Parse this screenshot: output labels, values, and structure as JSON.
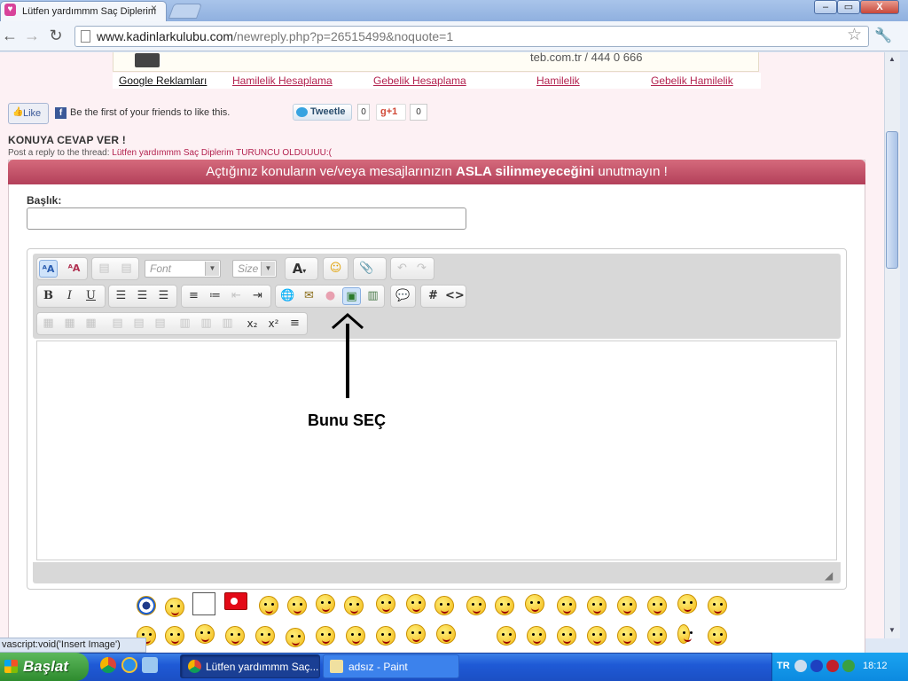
{
  "browser": {
    "tab_title": "Lütfen yardımmm Saç Diplerim",
    "tab_close": "×",
    "window_buttons": {
      "minimize": "–",
      "restore": "▭",
      "close": "X"
    },
    "url_host": "www.kadinlarkulubu.com",
    "url_path": "/newreply.php?p=26515499&noquote=1",
    "nav": {
      "back": "←",
      "forward": "→",
      "reload": "↻"
    }
  },
  "banner": {
    "text": "teb.com.tr / 444 0 666"
  },
  "ad_links": [
    "Google Reklamları",
    "Hamilelik Hesaplama",
    "Gebelik Hesaplama",
    "Hamilelik",
    "Gebelik Hamilelik"
  ],
  "social": {
    "like_label": "Like",
    "fb_text": "Be the first of your friends to like this.",
    "tweet_label": "Tweetle",
    "tweet_count": "0",
    "gplus_label": "+1",
    "gplus_count": "0"
  },
  "reply": {
    "title": "KONUYA CEVAP VER !",
    "subtitle_prefix": "Post a reply to the thread: ",
    "thread_title": "Lütfen yardımmm Saç Diplerim TURUNCU OLDUUUU:(",
    "notice_pre": "Açtığınız konuların ve/veya mesajlarınızın ",
    "notice_bold": "ASLA silinmeyeceğini",
    "notice_post": " unutmayın !",
    "title_label": "Başlık:"
  },
  "editor": {
    "font_placeholder": "Font",
    "size_placeholder": "Size",
    "text_color_label": "A",
    "bold": "B",
    "italic": "I",
    "underline": "U",
    "hash": "#",
    "code": "<>",
    "subscript": "x₂",
    "superscript": "x²"
  },
  "annotation": {
    "text": "Bunu SEÇ"
  },
  "statusbar": {
    "text": "vascript:void('Insert Image')"
  },
  "taskbar": {
    "start_label": "Başlat",
    "tasks": [
      "Lütfen yardımmm Saç...",
      "adsız - Paint"
    ],
    "lang": "TR",
    "clock": "18:12"
  },
  "colors": {
    "accent": "#b3405a",
    "link": "#b3224f",
    "taskbar": "#1f5ad6"
  }
}
